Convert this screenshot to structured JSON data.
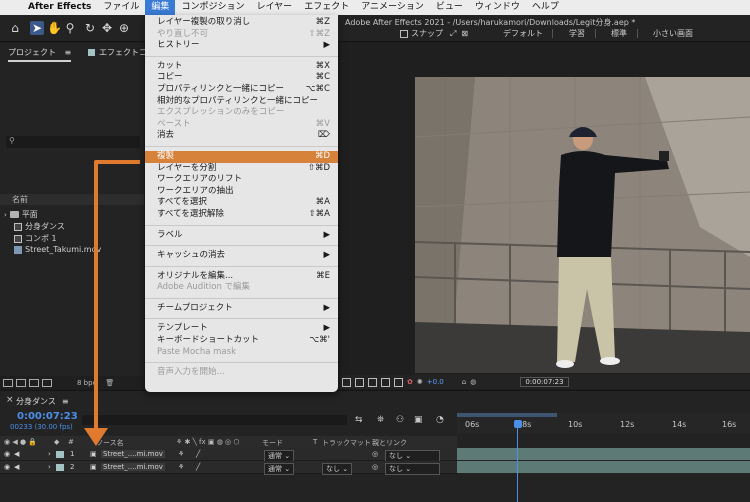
{
  "menubar": {
    "apple_glyph": "",
    "items": [
      "After Effects",
      "ファイル",
      "編集",
      "コンポジション",
      "レイヤー",
      "エフェクト",
      "アニメーション",
      "ビュー",
      "ウィンドウ",
      "ヘルプ"
    ],
    "active": "編集"
  },
  "window_title": "Adobe After Effects 2021 - /Users/harukamori/Downloads/Legit分身.aep *",
  "toolbar": {
    "snap_label": "スナップ",
    "workspaces": [
      "デフォルト",
      "学習",
      "標準",
      "小さい画面"
    ]
  },
  "project_panel": {
    "tab_project": "プロジェクト",
    "tab_effects": "エフェクトコ",
    "search_placeholder": "⚲",
    "column_name": "名前",
    "items": [
      {
        "type": "folder",
        "name": "平面"
      },
      {
        "type": "comp",
        "name": "分身ダンス"
      },
      {
        "type": "comp",
        "name": "コンポ 1"
      },
      {
        "type": "footage",
        "name": "Street_Takumi.mov"
      }
    ],
    "bpc": "8 bpc"
  },
  "viewer": {
    "exposure": "+0.0",
    "time": "0:00:07:23"
  },
  "edit_menu": {
    "groups": [
      [
        {
          "label": "レイヤー複製の取り消し",
          "shortcut": "⌘Z",
          "disabled": false
        },
        {
          "label": "やり直し不可",
          "shortcut": "⇧⌘Z",
          "disabled": true
        },
        {
          "label": "ヒストリー",
          "shortcut": "▶",
          "disabled": false
        }
      ],
      [
        {
          "label": "カット",
          "shortcut": "⌘X",
          "disabled": false
        },
        {
          "label": "コピー",
          "shortcut": "⌘C",
          "disabled": false
        },
        {
          "label": "プロパティリンクと一緒にコピー",
          "shortcut": "⌥⌘C",
          "disabled": false
        },
        {
          "label": "相対的なプロパティリンクと一緒にコピー",
          "shortcut": "",
          "disabled": false
        },
        {
          "label": "エクスプレッションのみをコピー",
          "shortcut": "",
          "disabled": true
        },
        {
          "label": "ペースト",
          "shortcut": "⌘V",
          "disabled": true
        },
        {
          "label": "消去",
          "shortcut": "⌦",
          "disabled": false
        }
      ],
      [
        {
          "label": "複製",
          "shortcut": "⌘D",
          "disabled": false,
          "highlighted": true
        },
        {
          "label": "レイヤーを分割",
          "shortcut": "⇧⌘D",
          "disabled": false
        },
        {
          "label": "ワークエリアのリフト",
          "shortcut": "",
          "disabled": false
        },
        {
          "label": "ワークエリアの抽出",
          "shortcut": "",
          "disabled": false
        },
        {
          "label": "すべてを選択",
          "shortcut": "⌘A",
          "disabled": false
        },
        {
          "label": "すべてを選択解除",
          "shortcut": "⇧⌘A",
          "disabled": false
        }
      ],
      [
        {
          "label": "ラベル",
          "shortcut": "▶",
          "disabled": false
        }
      ],
      [
        {
          "label": "キャッシュの消去",
          "shortcut": "▶",
          "disabled": false
        }
      ],
      [
        {
          "label": "オリジナルを編集...",
          "shortcut": "⌘E",
          "disabled": false
        },
        {
          "label": "Adobe Audition で編集",
          "shortcut": "",
          "disabled": true
        }
      ],
      [
        {
          "label": "チームプロジェクト",
          "shortcut": "▶",
          "disabled": false
        }
      ],
      [
        {
          "label": "テンプレート",
          "shortcut": "▶",
          "disabled": false
        },
        {
          "label": "キーボードショートカット",
          "shortcut": "⌥⌘'",
          "disabled": false
        },
        {
          "label": "Paste Mocha mask",
          "shortcut": "",
          "disabled": true
        }
      ],
      [
        {
          "label": "音声入力を開始...",
          "shortcut": "",
          "disabled": true
        }
      ]
    ]
  },
  "timeline": {
    "comp_tab": "分身ダンス",
    "timecode": "0:00:07:23",
    "frames": "00233 (30.00 fps)",
    "ruler_labels": [
      "06s",
      "08s",
      "10s",
      "12s",
      "14s",
      "16s"
    ],
    "columns": {
      "hash": "#",
      "source_name": "ソース名",
      "mode": "モード",
      "t": "T",
      "trackmatte": "トラックマット",
      "parent": "親とリンク"
    },
    "layers": [
      {
        "index": "1",
        "name": "Street_....mi.mov",
        "mode": "通常",
        "trackmatte": "",
        "parent": "なし"
      },
      {
        "index": "2",
        "name": "Street_....mi.mov",
        "mode": "通常",
        "trackmatte": "なし",
        "parent": "なし"
      }
    ]
  },
  "colors": {
    "menu_highlight": "#d7823b",
    "timecode_blue": "#4c8fe8",
    "annotation_orange": "#e07a2e",
    "label_swatch": "#a3c2c3"
  }
}
